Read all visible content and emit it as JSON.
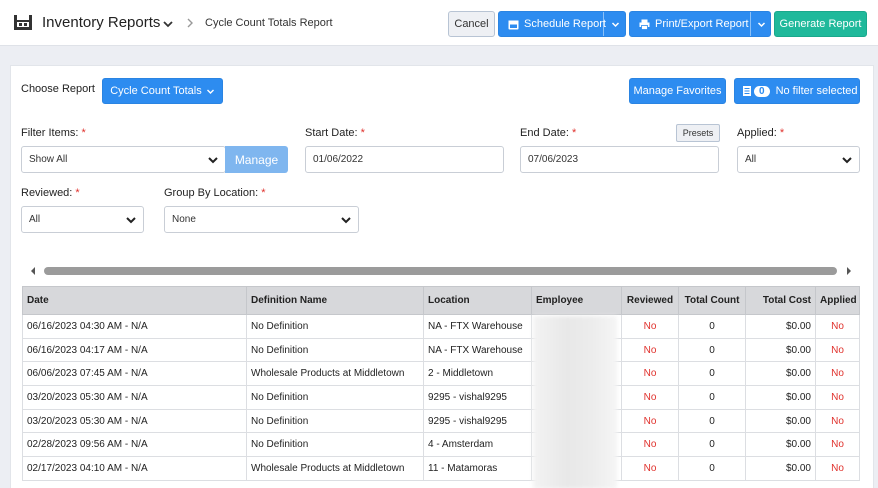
{
  "header": {
    "title": "Inventory Reports",
    "breadcrumb": "Cycle Count Totals Report",
    "cancel_label": "Cancel",
    "schedule_label": "Schedule Report",
    "print_label": "Print/Export Report",
    "generate_label": "Generate Report"
  },
  "toolbar": {
    "choose_report_label": "Choose Report",
    "report_select_value": "Cycle Count Totals",
    "manage_favorites_label": "Manage Favorites",
    "filter_count": "0",
    "filter_status": "No filter selected"
  },
  "filters": {
    "filter_items_label": "Filter Items:",
    "filter_items_value": "Show All",
    "manage_label": "Manage",
    "start_date_label": "Start Date:",
    "start_date_value": "01/06/2022",
    "end_date_label": "End Date:",
    "end_date_value": "07/06/2023",
    "presets_label": "Presets",
    "applied_label": "Applied:",
    "applied_value": "All",
    "reviewed_label": "Reviewed:",
    "reviewed_value": "All",
    "group_by_label": "Group By Location:",
    "group_by_value": "None",
    "required_mark": "*"
  },
  "table": {
    "columns": [
      "Date",
      "Definition Name",
      "Location",
      "Employee",
      "Reviewed",
      "Total Count",
      "Total Cost",
      "Applied"
    ],
    "rows": [
      [
        "06/16/2023 04:30 AM - N/A",
        "No Definition",
        "NA - FTX Warehouse",
        "",
        "No",
        "0",
        "$0.00",
        "No"
      ],
      [
        "06/16/2023 04:17 AM - N/A",
        "No Definition",
        "NA - FTX Warehouse",
        "",
        "No",
        "0",
        "$0.00",
        "No"
      ],
      [
        "06/06/2023 07:45 AM - N/A",
        "Wholesale Products at Middletown",
        "2 - Middletown",
        "",
        "No",
        "0",
        "$0.00",
        "No"
      ],
      [
        "03/20/2023 05:30 AM - N/A",
        "No Definition",
        "9295 - vishal9295",
        "",
        "No",
        "0",
        "$0.00",
        "No"
      ],
      [
        "03/20/2023 05:30 AM - N/A",
        "No Definition",
        "9295 - vishal9295",
        "",
        "No",
        "0",
        "$0.00",
        "No"
      ],
      [
        "02/28/2023 09:56 AM - N/A",
        "No Definition",
        "4 - Amsterdam",
        "",
        "No",
        "0",
        "$0.00",
        "No"
      ],
      [
        "02/17/2023 04:10 AM - N/A",
        "Wholesale Products at Middletown",
        "11 - Matamoras",
        "",
        "No",
        "0",
        "$0.00",
        "No"
      ]
    ]
  },
  "colors": {
    "primary_blue": "#2d8cf0",
    "green": "#1fb99b",
    "danger_red": "#e0312c"
  }
}
